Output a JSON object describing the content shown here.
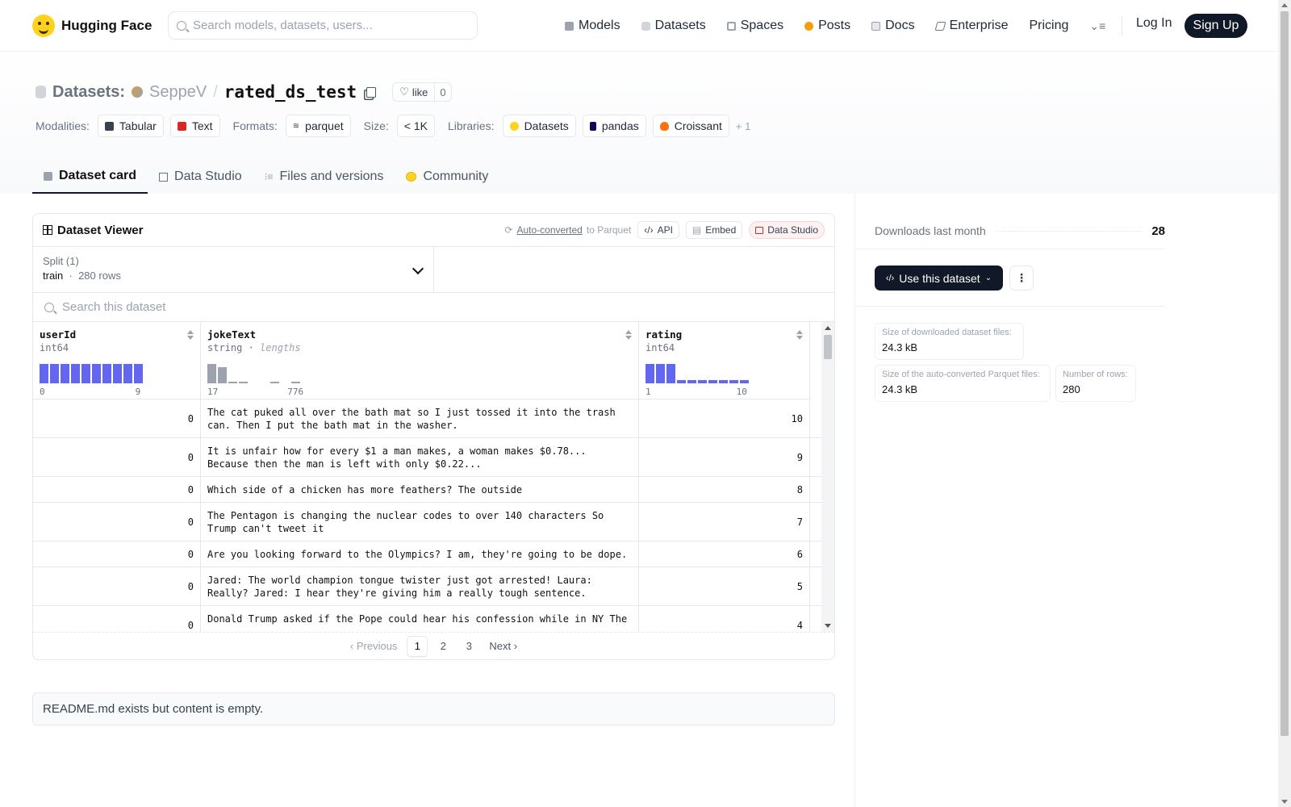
{
  "nav": {
    "brand": "Hugging Face",
    "search_placeholder": "Search models, datasets, users...",
    "links": [
      {
        "label": "Models",
        "icon": "cube-icon",
        "color": "#9ca3af"
      },
      {
        "label": "Datasets",
        "icon": "database-icon",
        "color": "#d1d5db"
      },
      {
        "label": "Spaces",
        "icon": "grid-icon",
        "color": "#9ca3af"
      },
      {
        "label": "Posts",
        "icon": "posts-icon",
        "color": "#f59e0b"
      },
      {
        "label": "Docs",
        "icon": "book-icon",
        "color": "#9ca3af"
      },
      {
        "label": "Enterprise",
        "icon": "enterprise-icon",
        "color": "#6b7280"
      },
      {
        "label": "Pricing"
      }
    ],
    "login": "Log In",
    "signup": "Sign Up"
  },
  "repo": {
    "category": "Datasets:",
    "owner": "SeppeV",
    "separator": "/",
    "name": "rated_ds_test",
    "like_label": "like",
    "like_count": "0"
  },
  "tags": {
    "modalities_label": "Modalities:",
    "modalities": [
      "Tabular",
      "Text"
    ],
    "formats_label": "Formats:",
    "format": "parquet",
    "size_label": "Size:",
    "size": "< 1K",
    "libraries_label": "Libraries:",
    "libraries": [
      "Datasets",
      "pandas",
      "Croissant"
    ],
    "more": "+ 1"
  },
  "tabs": [
    "Dataset card",
    "Data Studio",
    "Files and versions",
    "Community"
  ],
  "viewer": {
    "title": "Dataset Viewer",
    "auto_converted": "Auto-converted",
    "to_parquet": "to Parquet",
    "api": "API",
    "embed": "Embed",
    "data_studio": "Data Studio",
    "split_label": "Split (1)",
    "split_name": "train",
    "split_rows": "280 rows",
    "search_placeholder": "Search this dataset",
    "columns": [
      {
        "name": "userId",
        "type": "int64",
        "extra": "",
        "min": "0",
        "max": "9"
      },
      {
        "name": "jokeText",
        "type": "string",
        "extra": "lengths",
        "min": "17",
        "max": "776"
      },
      {
        "name": "rating",
        "type": "int64",
        "extra": "",
        "min": "1",
        "max": "10"
      }
    ],
    "hist_userId": [
      1,
      1,
      1,
      1,
      1,
      1,
      1,
      1,
      1,
      1
    ],
    "hist_jokeText": [
      1,
      0.85,
      0.08,
      0.06,
      0,
      0,
      0.05,
      0,
      0.04
    ],
    "hist_rating": [
      1,
      1,
      1,
      0.15,
      0.15,
      0.15,
      0.15,
      0.15,
      0.15,
      0.15
    ],
    "rows": [
      {
        "userId": "0",
        "jokeText": "The cat puked all over the bath mat so I just tossed it into the trash can. Then I put the bath mat in the washer.",
        "rating": "10"
      },
      {
        "userId": "0",
        "jokeText": "It is unfair how for every $1 a man makes, a woman makes $0.78... Because then the man is left with only $0.22...",
        "rating": "9"
      },
      {
        "userId": "0",
        "jokeText": "Which side of a chicken has more feathers? The outside",
        "rating": "8"
      },
      {
        "userId": "0",
        "jokeText": "The Pentagon is changing the nuclear codes to over 140 characters So Trump can't tweet it",
        "rating": "7"
      },
      {
        "userId": "0",
        "jokeText": "Are you looking forward to the Olympics? I am, they're going to be dope.",
        "rating": "6"
      },
      {
        "userId": "0",
        "jokeText": "Jared: The world champion tongue twister just got arrested! Laura: Really? Jared: I hear they're giving him a really tough sentence.",
        "rating": "5"
      },
      {
        "userId": "0",
        "jokeText": "Donald Trump asked if the Pope could hear his confession while in NY The",
        "rating": "4"
      }
    ],
    "pager": {
      "prev": "Previous",
      "pages": [
        "1",
        "2",
        "3"
      ],
      "next": "Next"
    }
  },
  "readme": "README.md exists but content is empty.",
  "sidebar": {
    "downloads_label": "Downloads last month",
    "downloads_value": "28",
    "use_button": "Use this dataset",
    "more": "⋮",
    "stats": [
      {
        "label": "Size of downloaded dataset files:",
        "value": "24.3 kB"
      },
      {
        "label": "Size of the auto-converted Parquet files:",
        "value": "24.3 kB"
      },
      {
        "label": "Number of rows:",
        "value": "280"
      }
    ]
  },
  "colors": {
    "accent_bar": "#6366f1",
    "gray_bar": "#9ca3af",
    "brand": "#FFD21E"
  }
}
